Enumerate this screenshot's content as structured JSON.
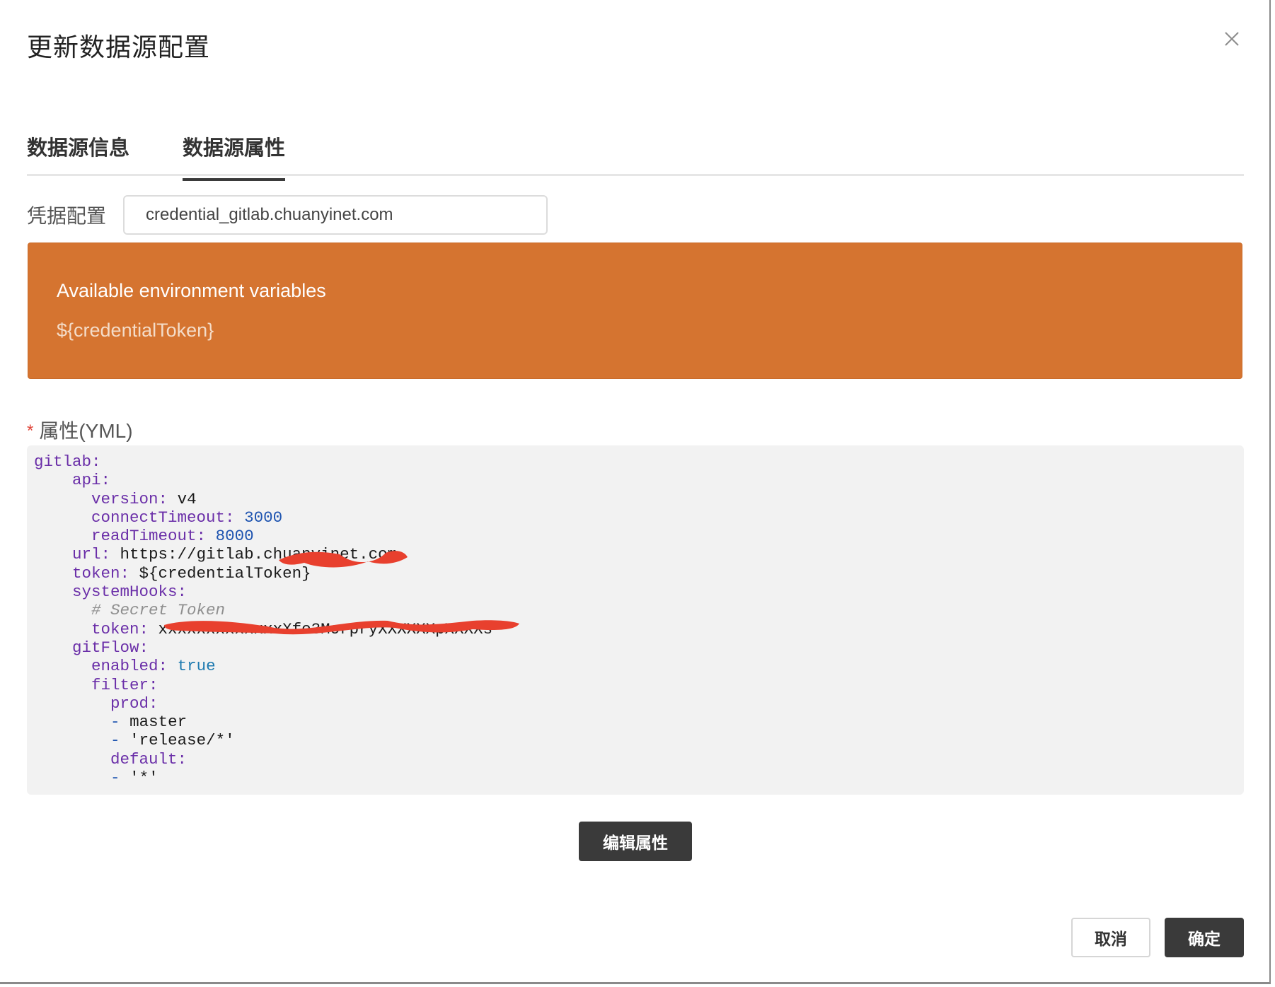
{
  "dialog": {
    "title": "更新数据源配置",
    "close_icon": "close-icon"
  },
  "tabs": [
    {
      "label": "数据源信息",
      "active": false
    },
    {
      "label": "数据源属性",
      "active": true
    }
  ],
  "credential": {
    "label": "凭据配置",
    "value": "credential_gitlab.chuanyinet.com"
  },
  "alert": {
    "title": "Available environment variables",
    "variable": "${credentialToken}",
    "color": "#d57430"
  },
  "properties": {
    "required_mark": "*",
    "label": "属性(YML)",
    "yml": {
      "l1": "gitlab:",
      "l2": "api:",
      "l3_key": "version:",
      "l3_val": "v4",
      "l4_key": "connectTimeout:",
      "l4_val": "3000",
      "l5_key": "readTimeout:",
      "l5_val": "8000",
      "l6_key": "url:",
      "l6_val": "https://gitlab.chuanyinet.com",
      "l7_key": "token:",
      "l7_val": "${credentialToken}",
      "l8": "systemHooks:",
      "l9": "# Secret Token",
      "l10_key": "token:",
      "l10_val": "xxxxxxxxxxxxxXfo3MorpryXXXXXXpXXXXs",
      "l11": "gitFlow:",
      "l12_key": "enabled:",
      "l12_val": "true",
      "l13": "filter:",
      "l14": "prod:",
      "l15_dash": "-",
      "l15_val": "master",
      "l16_dash": "-",
      "l16_val": "'release/*'",
      "l17": "default:",
      "l18_dash": "-",
      "l18_val": "'*'"
    }
  },
  "buttons": {
    "edit": "编辑属性",
    "cancel": "取消",
    "ok": "确定"
  },
  "colors": {
    "primary_button": "#3a3a3a",
    "yml_key": "#6a2ea8",
    "yml_number": "#1e54b0",
    "redaction": "#e8402e"
  }
}
